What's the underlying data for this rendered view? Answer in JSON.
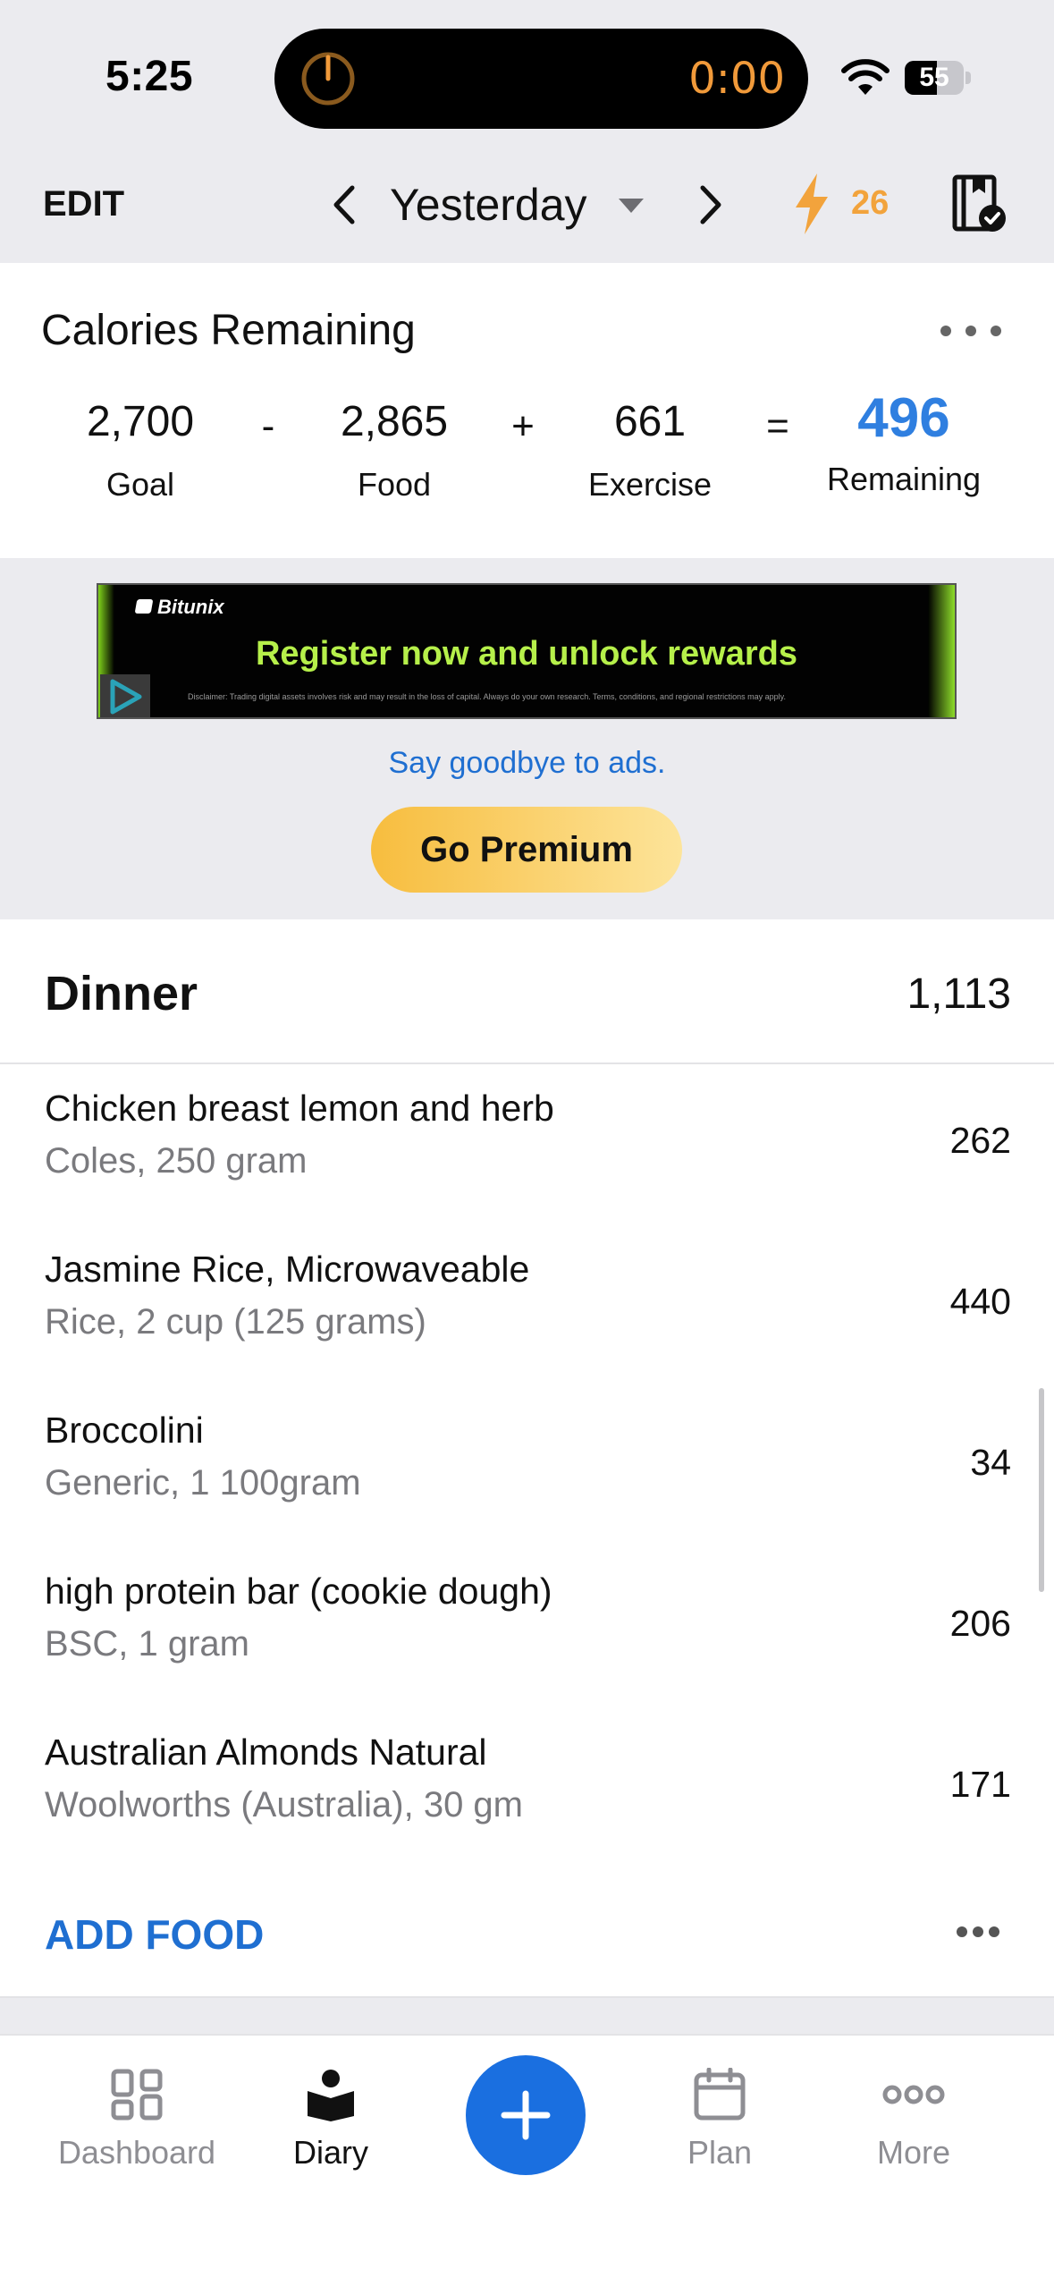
{
  "status_bar": {
    "time": "5:25",
    "timer": "0:00",
    "battery": "55",
    "battery_level": 0.55
  },
  "topbar": {
    "edit_label": "EDIT",
    "date_label": "Yesterday",
    "streak_count": "26",
    "accent_color": "#f2a33c"
  },
  "calories": {
    "title": "Calories Remaining",
    "goal_value": "2,700",
    "goal_label": "Goal",
    "minus": "-",
    "food_value": "2,865",
    "food_label": "Food",
    "plus": "+",
    "exercise_value": "661",
    "exercise_label": "Exercise",
    "equals": "=",
    "remaining_value": "496",
    "remaining_label": "Remaining",
    "remaining_color": "#2f7fe0"
  },
  "ad": {
    "brand": "Bitunix",
    "headline": "Register now and unlock rewards",
    "disclaimer": "Disclaimer: Trading digital assets involves risk and may result in the loss of capital. Always do your own research. Terms, conditions, and regional restrictions may apply.",
    "say_goodbye": "Say goodbye to ads.",
    "premium_button": "Go Premium"
  },
  "meal": {
    "name": "Dinner",
    "total": "1,113",
    "items": [
      {
        "name": "Chicken breast lemon and herb",
        "detail": "Coles, 250 gram",
        "calories": "262"
      },
      {
        "name": "Jasmine Rice, Microwaveable",
        "detail": "Rice, 2 cup (125 grams)",
        "calories": "440"
      },
      {
        "name": "Broccolini",
        "detail": "Generic, 1 100gram",
        "calories": "34"
      },
      {
        "name": "high protein bar (cookie dough)",
        "detail": "BSC, 1 gram",
        "calories": "206"
      },
      {
        "name": "Australian Almonds Natural",
        "detail": "Woolworths (Australia), 30 gm",
        "calories": "171"
      }
    ],
    "add_food_label": "ADD FOOD"
  },
  "tabs": [
    {
      "label": "Dashboard",
      "icon": "grid-icon",
      "active": false
    },
    {
      "label": "Diary",
      "icon": "diary-icon",
      "active": true
    },
    {
      "label": "",
      "icon": "plus-icon",
      "active": false
    },
    {
      "label": "Plan",
      "icon": "calendar-icon",
      "active": false
    },
    {
      "label": "More",
      "icon": "more-icon",
      "active": false
    }
  ],
  "colors": {
    "primary_blue": "#1a6fe0",
    "link_blue": "#1f6fd1"
  }
}
